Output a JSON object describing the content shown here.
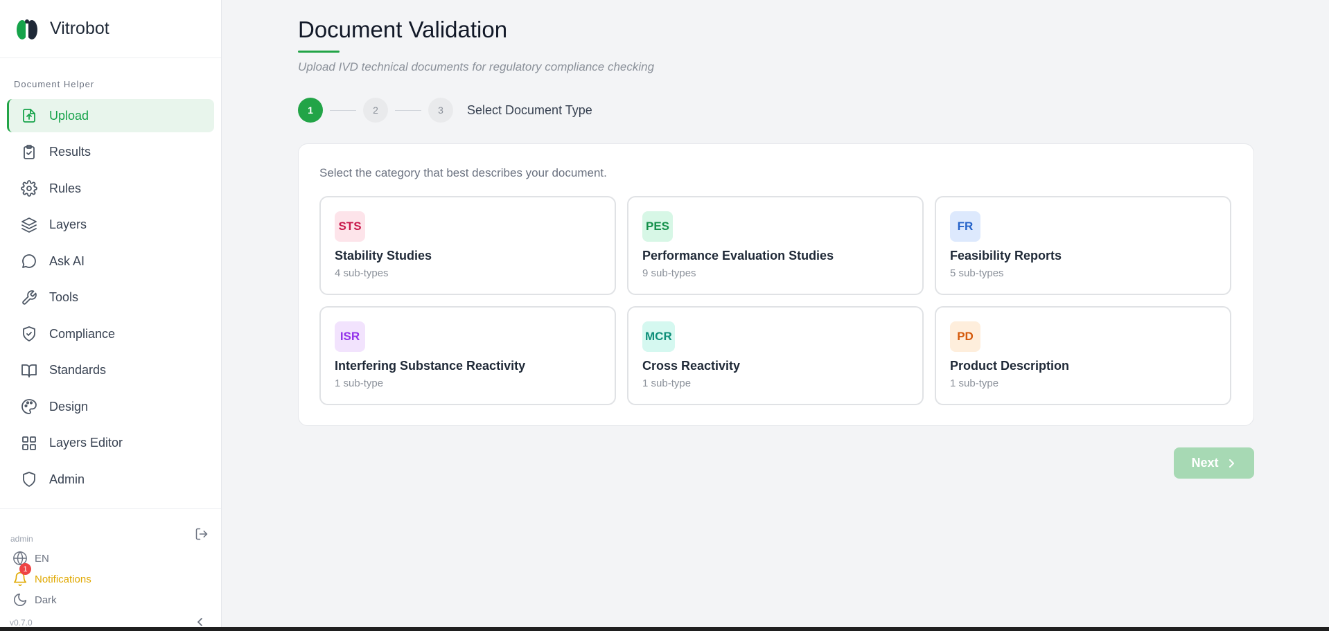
{
  "brand": {
    "name": "Vitrobot"
  },
  "sidebar": {
    "section_label": "Document Helper",
    "items": [
      {
        "label": "Upload",
        "icon": "upload-file-icon",
        "active": true
      },
      {
        "label": "Results",
        "icon": "clipboard-check-icon"
      },
      {
        "label": "Rules",
        "icon": "gear-icon"
      },
      {
        "label": "Layers",
        "icon": "layers-icon"
      },
      {
        "label": "Ask AI",
        "icon": "chat-bubble-icon"
      },
      {
        "label": "Tools",
        "icon": "wrench-icon"
      },
      {
        "label": "Compliance",
        "icon": "shield-check-icon"
      },
      {
        "label": "Standards",
        "icon": "book-open-icon"
      },
      {
        "label": "Design",
        "icon": "palette-icon"
      },
      {
        "label": "Layers Editor",
        "icon": "grid-icon"
      },
      {
        "label": "Admin",
        "icon": "shield-icon"
      }
    ],
    "footer": {
      "user": "admin",
      "language": "EN",
      "notifications_label": "Notifications",
      "notifications_count": "1",
      "theme_label": "Dark",
      "version": "v0.7.0"
    }
  },
  "main": {
    "title": "Document Validation",
    "subtitle": "Upload IVD technical documents for regulatory compliance checking",
    "stepper": {
      "steps": [
        "1",
        "2",
        "3"
      ],
      "current_label": "Select Document Type"
    },
    "hint": "Select the category that best describes your document.",
    "categories": [
      {
        "code": "STS",
        "name": "Stability Studies",
        "subtypes": "4 sub-types",
        "bg": "#fde4ea",
        "fg": "#c8194b"
      },
      {
        "code": "PES",
        "name": "Performance Evaluation Studies",
        "subtypes": "9 sub-types",
        "bg": "#d7f7e6",
        "fg": "#14904a"
      },
      {
        "code": "FR",
        "name": "Feasibility Reports",
        "subtypes": "5 sub-types",
        "bg": "#dde9fd",
        "fg": "#2563c9"
      },
      {
        "code": "ISR",
        "name": "Interfering Substance Reactivity",
        "subtypes": "1 sub-type",
        "bg": "#f2e3fd",
        "fg": "#9333ea"
      },
      {
        "code": "MCR",
        "name": "Cross Reactivity",
        "subtypes": "1 sub-type",
        "bg": "#d5f8f0",
        "fg": "#0f8f7a"
      },
      {
        "code": "PD",
        "name": "Product Description",
        "subtypes": "1 sub-type",
        "bg": "#feeedc",
        "fg": "#d55a0c"
      }
    ],
    "next_label": "Next"
  },
  "colors": {
    "accent": "#22a447",
    "active_bg": "#e8f5ec",
    "next_disabled": "#a7d9b4",
    "notification": "#e0a800",
    "badge": "#ef4444"
  }
}
